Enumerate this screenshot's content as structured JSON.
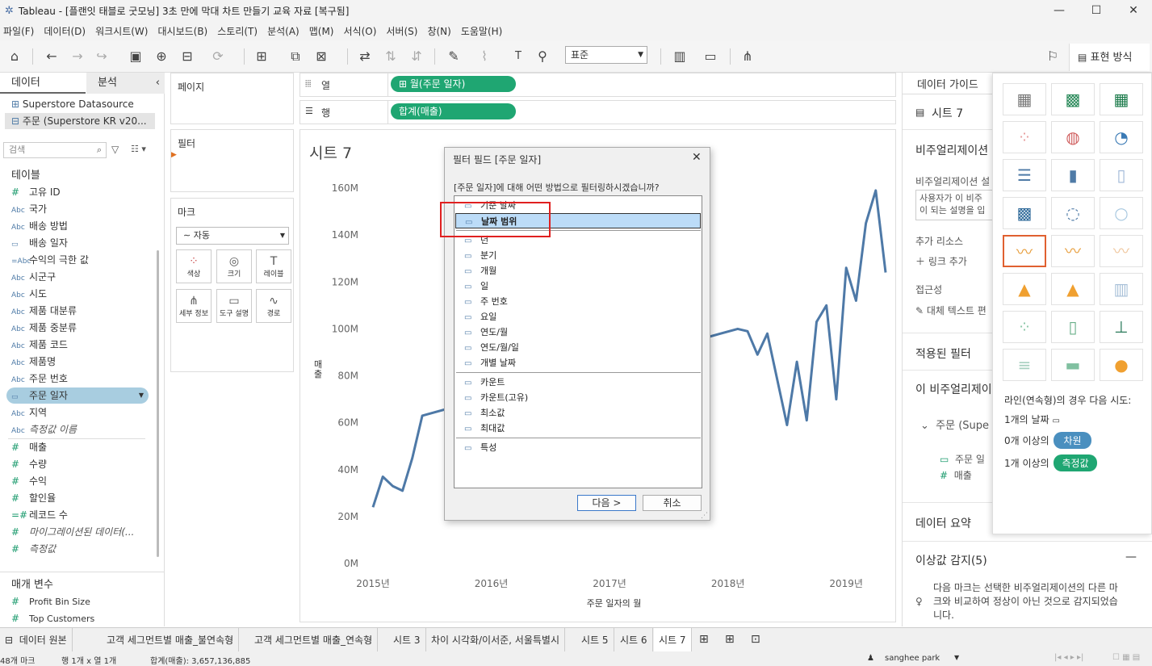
{
  "window": {
    "title": "Tableau - [플랜잇 태블로 굿모닝] 3초 만에 막대 차트 만들기 교육 자료 [복구됨]"
  },
  "menu": [
    "파일(F)",
    "데이터(D)",
    "워크시트(W)",
    "대시보드(B)",
    "스토리(T)",
    "분석(A)",
    "맵(M)",
    "서식(O)",
    "서버(S)",
    "창(N)",
    "도움말(H)"
  ],
  "toolbar": {
    "fit_select": "표준",
    "show_me": "표현 방식"
  },
  "data_pane": {
    "tab_data": "데이터",
    "tab_analysis": "분석",
    "datasources": [
      "Superstore Datasource",
      "주문 (Superstore KR v20..."
    ],
    "search_placeholder": "검색",
    "tables_header": "테이블",
    "dimensions": [
      {
        "icon": "#",
        "name": "고유 ID"
      },
      {
        "icon": "Abc",
        "name": "국가"
      },
      {
        "icon": "Abc",
        "name": "배송 방법"
      },
      {
        "icon": "▭",
        "name": "배송 일자"
      },
      {
        "icon": "=Abc",
        "name": "수익의 극한 값"
      },
      {
        "icon": "Abc",
        "name": "시군구"
      },
      {
        "icon": "Abc",
        "name": "시도"
      },
      {
        "icon": "Abc",
        "name": "제품 대분류"
      },
      {
        "icon": "Abc",
        "name": "제품 중분류"
      },
      {
        "icon": "Abc",
        "name": "제품 코드"
      },
      {
        "icon": "Abc",
        "name": "제품명"
      },
      {
        "icon": "Abc",
        "name": "주문 번호"
      },
      {
        "icon": "▭",
        "name": "주문 일자"
      },
      {
        "icon": "Abc",
        "name": "지역"
      },
      {
        "icon": "Abc",
        "name": "측정값 이름"
      }
    ],
    "measures": [
      {
        "icon": "#",
        "name": "매출"
      },
      {
        "icon": "#",
        "name": "수량"
      },
      {
        "icon": "#",
        "name": "수익"
      },
      {
        "icon": "#",
        "name": "할인율"
      },
      {
        "icon": "=#",
        "name": "레코드 수"
      },
      {
        "icon": "#",
        "name": "마이그레이션된 데이터(..."
      },
      {
        "icon": "#",
        "name": "측정값"
      }
    ],
    "params_header": "매개 변수",
    "params": [
      {
        "icon": "#",
        "name": "Profit Bin Size"
      },
      {
        "icon": "#",
        "name": "Top Customers"
      }
    ]
  },
  "shelves": {
    "pages": "페이지",
    "filters": "필터",
    "marks": "마크",
    "mark_type": "자동",
    "mark_cards": [
      "색상",
      "크기",
      "레이블",
      "세부 정보",
      "도구 설명",
      "경로"
    ],
    "columns_label": "열",
    "rows_label": "행",
    "columns_pill": "월(주문 일자)",
    "rows_pill": "합계(매출)"
  },
  "sheet": {
    "title": "시트 7"
  },
  "chart_data": {
    "type": "line",
    "title": "",
    "xlabel": "주문 일자의 월",
    "ylabel": "매출",
    "x_ticks": [
      "2015년",
      "2016년",
      "2017년",
      "2018년",
      "2019년"
    ],
    "y_ticks": [
      "0M",
      "20M",
      "40M",
      "60M",
      "80M",
      "100M",
      "120M",
      "140M",
      "160M"
    ],
    "ylim": [
      0,
      160
    ],
    "series": [
      {
        "values": [
          {
            "x": "2015-01",
            "y": 24
          },
          {
            "x": "2015-02",
            "y": 37
          },
          {
            "x": "2015-03",
            "y": 33
          },
          {
            "x": "2015-04",
            "y": 31
          },
          {
            "x": "2015-05",
            "y": 45
          },
          {
            "x": "2015-06",
            "y": 63
          },
          {
            "x": "2018-02",
            "y": 100
          },
          {
            "x": "2018-03",
            "y": 99
          },
          {
            "x": "2018-04",
            "y": 89
          },
          {
            "x": "2018-05",
            "y": 98
          },
          {
            "x": "2018-07",
            "y": 59
          },
          {
            "x": "2018-08",
            "y": 86
          },
          {
            "x": "2018-09",
            "y": 61
          },
          {
            "x": "2018-10",
            "y": 103
          },
          {
            "x": "2018-11",
            "y": 110
          },
          {
            "x": "2018-12",
            "y": 70
          },
          {
            "x": "2019-01",
            "y": 126
          },
          {
            "x": "2019-02",
            "y": 112
          },
          {
            "x": "2019-03",
            "y": 145
          },
          {
            "x": "2019-04",
            "y": 159
          },
          {
            "x": "2019-05",
            "y": 124
          }
        ]
      }
    ]
  },
  "dialog": {
    "title": "필터 필드 [주문 일자]",
    "question": "[주문 일자]에 대해 어떤 방법으로 필터링하시겠습니까?",
    "group1": [
      "기준 날짜",
      "날짜 범위"
    ],
    "selected": "날짜 범위",
    "group2": [
      "년",
      "분기",
      "개월",
      "일",
      "주 번호",
      "요일",
      "연도/월",
      "연도/월/일",
      "개별 날짜"
    ],
    "group3": [
      "카운트",
      "카운트(고유)",
      "최소값",
      "최대값"
    ],
    "group4": [
      "특성"
    ],
    "next_button": "다음 >",
    "cancel_button": "취소"
  },
  "guide": {
    "tab": "데이터 가이드",
    "sheet_name": "시트 7",
    "viz_section": "비주얼리제이션",
    "viz_desc_label": "비주얼리제이션 설",
    "viz_desc_text": [
      "사용자가 이 비주",
      "이 되는 설명을 입"
    ],
    "resources_label": "추가 리소스",
    "add_link": "링크 추가",
    "accessibility": "접근성",
    "alt_text": "대체 텍스트 편",
    "applied_filters": "적용된 필터",
    "this_viz": "이 비주얼리제이",
    "tree_root": "주문 (Supe",
    "tree_items": [
      "주문 일",
      "매출"
    ],
    "data_summary": "데이터 요약",
    "outliers": "이상값 감지(5)",
    "outlier_text": [
      "다음 마크는 선택한 비주얼리제이션의 다른 마",
      "크와 비교하여 정상이 아닌 것으로 감지되었습",
      "니다."
    ]
  },
  "showme": {
    "hint": "라인(연속형)의 경우 다음 시도:",
    "req1_label": "1개의 날짜",
    "req2_label": "0개 이상의",
    "req2_pill": "차원",
    "req3_label": "1개 이상의",
    "req3_pill": "측정값",
    "pill_dim_color": "#4a8fbf",
    "pill_meas_color": "#1fa672"
  },
  "sheet_tabs": [
    "데이터 원본",
    "고객 세그먼트별 매출_불연속형",
    "고객 세그먼트별 매출_연속형",
    "시트 3",
    "차이 시각화/이서준, 서울특별시",
    "시트 5",
    "시트 6",
    "시트 7"
  ],
  "active_tab": "시트 7",
  "status": {
    "marks": "48개 마크",
    "rows_cols": "행 1개 x 열 1개",
    "sum": "합계(매출): 3,657,136,885",
    "user": "sanghee park"
  }
}
